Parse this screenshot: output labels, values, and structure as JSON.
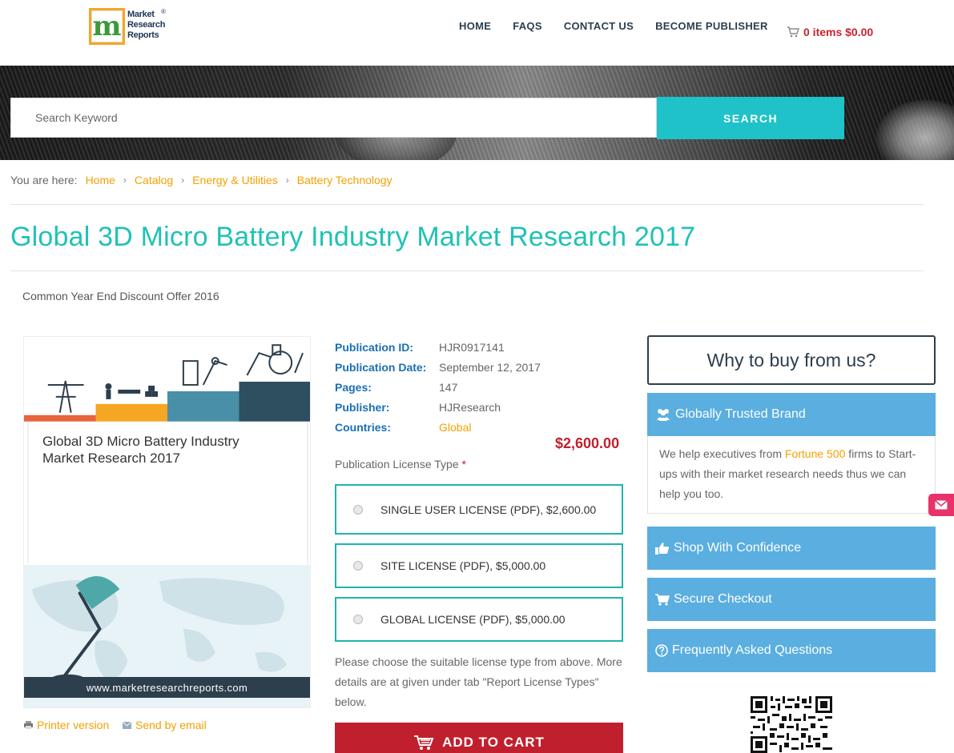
{
  "header": {
    "logo_text_lines": [
      "Market",
      "Research",
      "Reports"
    ],
    "logo_letter": "m",
    "nav": [
      "HOME",
      "FAQS",
      "CONTACT US",
      "BECOME PUBLISHER"
    ],
    "cart": "0 items $0.00"
  },
  "search": {
    "placeholder": "Search Keyword",
    "button": "SEARCH"
  },
  "breadcrumb": {
    "lead": "You are here:",
    "items": [
      "Home",
      "Catalog",
      "Energy & Utilities",
      "Battery Technology"
    ]
  },
  "page": {
    "title": "Global 3D Micro Battery Industry Market Research 2017",
    "discount": "Common Year End Discount Offer 2016"
  },
  "cover": {
    "title": "Global 3D Micro Battery Industry Market Research 2017",
    "url": "www.marketresearchreports.com"
  },
  "links": {
    "printer": "Printer version",
    "email": "Send by email"
  },
  "meta": [
    {
      "k": "Publication ID:",
      "v": "HJR0917141"
    },
    {
      "k": "Publication Date:",
      "v": "September 12, 2017"
    },
    {
      "k": "Pages:",
      "v": "147"
    },
    {
      "k": "Publisher:",
      "v": "HJResearch"
    },
    {
      "k": "Countries:",
      "v": "Global"
    }
  ],
  "price": "$2,600.00",
  "license": {
    "label": "Publication License Type",
    "required": "*",
    "options": [
      "SINGLE USER LICENSE (PDF), $2,600.00",
      "SITE LICENSE (PDF), $5,000.00",
      "GLOBAL LICENSE (PDF), $5,000.00"
    ],
    "help": "Please choose the suitable license type from above. More details are at given under tab \"Report License Types\" below.",
    "add_to_cart": "ADD TO CART"
  },
  "why": {
    "title": "Why to buy from us?",
    "trusted": "Globally Trusted Brand",
    "trusted_text_1": "We help executives from ",
    "trusted_highlight": "Fortune 500",
    "trusted_text_2": " firms to Start-ups with their market research needs thus we can help you too.",
    "shop": "Shop With Confidence",
    "secure": "Secure Checkout",
    "faq": "Frequently Asked Questions"
  },
  "colors": {
    "accent_teal": "#1fc2c8",
    "title_teal": "#1fc2b5",
    "link_orange": "#f5a000",
    "price_red": "#c0202d",
    "side_blue": "#5aaee0"
  }
}
